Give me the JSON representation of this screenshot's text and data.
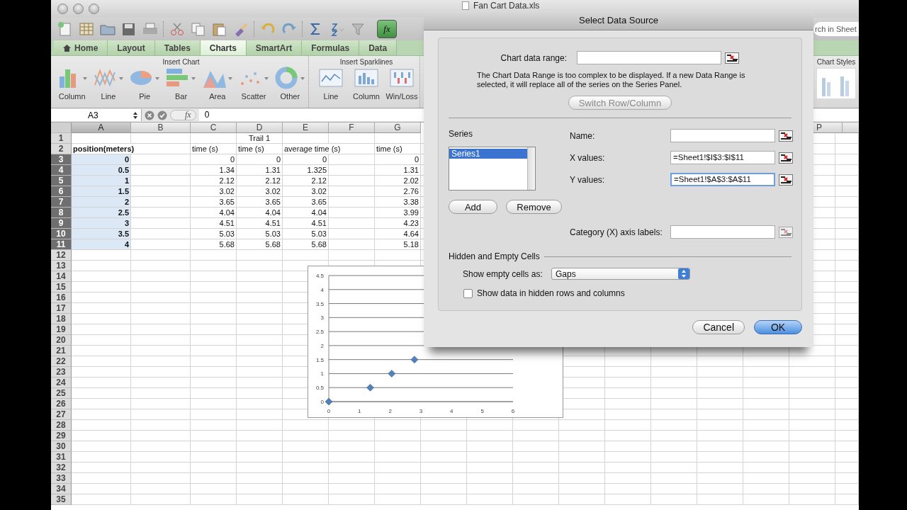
{
  "window": {
    "title": "Fan Cart Data.xls"
  },
  "toolbar": {
    "formula_builder": "fx",
    "search": {
      "placeholder": "rch in Sheet"
    }
  },
  "tabs": [
    {
      "label": "Home",
      "selected": false
    },
    {
      "label": "Layout",
      "selected": false
    },
    {
      "label": "Tables",
      "selected": false
    },
    {
      "label": "Charts",
      "selected": true
    },
    {
      "label": "SmartArt",
      "selected": false
    },
    {
      "label": "Formulas",
      "selected": false
    },
    {
      "label": "Data",
      "selected": false
    }
  ],
  "ribbon": {
    "groups": [
      {
        "kind": "chart",
        "title": "Insert Chart",
        "buttons": [
          "Column",
          "Line",
          "Pie",
          "Bar",
          "Area",
          "Scatter",
          "Other"
        ]
      },
      {
        "kind": "sparkline",
        "title": "Insert Sparklines",
        "buttons": [
          "Line",
          "Column",
          "Win/Loss"
        ]
      },
      {
        "kind": "styles",
        "title": "Chart Styles"
      }
    ]
  },
  "formula_bar": {
    "cell": "A3",
    "fx": "fx",
    "value": "0"
  },
  "sheet": {
    "columns": [
      {
        "label": "A",
        "selected": true
      },
      {
        "label": "B",
        "selected": false
      },
      {
        "label": "C",
        "selected": false
      },
      {
        "label": "D",
        "selected": false
      },
      {
        "label": "E",
        "selected": false
      },
      {
        "label": "F",
        "selected": false
      },
      {
        "label": "G",
        "selected": false
      },
      {
        "label": "P",
        "selected": false
      }
    ],
    "rows": [
      {
        "label": "1",
        "selected": false,
        "cells": [
          null,
          null,
          null,
          {
            "text": "Trail 1",
            "kind": "title",
            "bold": false,
            "selected": false
          },
          null,
          null,
          null,
          null
        ]
      },
      {
        "label": "2",
        "selected": false,
        "cells": [
          {
            "text": "position(meters)",
            "kind": "text",
            "bold": true,
            "selected": false
          },
          null,
          {
            "text": "time (s)",
            "kind": "text",
            "bold": false,
            "selected": false
          },
          {
            "text": "time (s)",
            "kind": "text",
            "bold": false,
            "selected": false
          },
          {
            "text": "average time (s)",
            "kind": "text",
            "bold": false,
            "selected": false
          },
          null,
          {
            "text": "time (s)",
            "kind": "text",
            "bold": false,
            "selected": false
          },
          null
        ]
      },
      {
        "label": "3",
        "selected": true,
        "cells": [
          {
            "text": "0",
            "kind": "number",
            "bold": true,
            "selected": true
          },
          null,
          {
            "text": "0",
            "kind": "number",
            "bold": false,
            "selected": false
          },
          {
            "text": "0",
            "kind": "number",
            "bold": false,
            "selected": false
          },
          {
            "text": "0",
            "kind": "number",
            "bold": false,
            "selected": false
          },
          null,
          {
            "text": "0",
            "kind": "number",
            "bold": false,
            "selected": false
          },
          null
        ]
      },
      {
        "label": "4",
        "selected": true,
        "cells": [
          {
            "text": "0.5",
            "kind": "number",
            "bold": true,
            "selected": true
          },
          null,
          {
            "text": "1.34",
            "kind": "number",
            "bold": false,
            "selected": false
          },
          {
            "text": "1.31",
            "kind": "number",
            "bold": false,
            "selected": false
          },
          {
            "text": "1.325",
            "kind": "number",
            "bold": false,
            "selected": false
          },
          null,
          {
            "text": "1.31",
            "kind": "number",
            "bold": false,
            "selected": false
          },
          null
        ]
      },
      {
        "label": "5",
        "selected": true,
        "cells": [
          {
            "text": "1",
            "kind": "number",
            "bold": true,
            "selected": true
          },
          null,
          {
            "text": "2.12",
            "kind": "number",
            "bold": false,
            "selected": false
          },
          {
            "text": "2.12",
            "kind": "number",
            "bold": false,
            "selected": false
          },
          {
            "text": "2.12",
            "kind": "number",
            "bold": false,
            "selected": false
          },
          null,
          {
            "text": "2.02",
            "kind": "number",
            "bold": false,
            "selected": false
          },
          null
        ]
      },
      {
        "label": "6",
        "selected": true,
        "cells": [
          {
            "text": "1.5",
            "kind": "number",
            "bold": true,
            "selected": true
          },
          null,
          {
            "text": "3.02",
            "kind": "number",
            "bold": false,
            "selected": false
          },
          {
            "text": "3.02",
            "kind": "number",
            "bold": false,
            "selected": false
          },
          {
            "text": "3.02",
            "kind": "number",
            "bold": false,
            "selected": false
          },
          null,
          {
            "text": "2.76",
            "kind": "number",
            "bold": false,
            "selected": false
          },
          null
        ]
      },
      {
        "label": "7",
        "selected": true,
        "cells": [
          {
            "text": "2",
            "kind": "number",
            "bold": true,
            "selected": true
          },
          null,
          {
            "text": "3.65",
            "kind": "number",
            "bold": false,
            "selected": false
          },
          {
            "text": "3.65",
            "kind": "number",
            "bold": false,
            "selected": false
          },
          {
            "text": "3.65",
            "kind": "number",
            "bold": false,
            "selected": false
          },
          null,
          {
            "text": "3.38",
            "kind": "number",
            "bold": false,
            "selected": false
          },
          null
        ]
      },
      {
        "label": "8",
        "selected": true,
        "cells": [
          {
            "text": "2.5",
            "kind": "number",
            "bold": true,
            "selected": true
          },
          null,
          {
            "text": "4.04",
            "kind": "number",
            "bold": false,
            "selected": false
          },
          {
            "text": "4.04",
            "kind": "number",
            "bold": false,
            "selected": false
          },
          {
            "text": "4.04",
            "kind": "number",
            "bold": false,
            "selected": false
          },
          null,
          {
            "text": "3.99",
            "kind": "number",
            "bold": false,
            "selected": false
          },
          null
        ]
      },
      {
        "label": "9",
        "selected": true,
        "cells": [
          {
            "text": "3",
            "kind": "number",
            "bold": true,
            "selected": true
          },
          null,
          {
            "text": "4.51",
            "kind": "number",
            "bold": false,
            "selected": false
          },
          {
            "text": "4.51",
            "kind": "number",
            "bold": false,
            "selected": false
          },
          {
            "text": "4.51",
            "kind": "number",
            "bold": false,
            "selected": false
          },
          null,
          {
            "text": "4.23",
            "kind": "number",
            "bold": false,
            "selected": false
          },
          null
        ]
      },
      {
        "label": "10",
        "selected": true,
        "cells": [
          {
            "text": "3.5",
            "kind": "number",
            "bold": true,
            "selected": true
          },
          null,
          {
            "text": "5.03",
            "kind": "number",
            "bold": false,
            "selected": false
          },
          {
            "text": "5.03",
            "kind": "number",
            "bold": false,
            "selected": false
          },
          {
            "text": "5.03",
            "kind": "number",
            "bold": false,
            "selected": false
          },
          null,
          {
            "text": "4.64",
            "kind": "number",
            "bold": false,
            "selected": false
          },
          null
        ]
      },
      {
        "label": "11",
        "selected": true,
        "cells": [
          {
            "text": "4",
            "kind": "number",
            "bold": true,
            "selected": true
          },
          null,
          {
            "text": "5.68",
            "kind": "number",
            "bold": false,
            "selected": false
          },
          {
            "text": "5.68",
            "kind": "number",
            "bold": false,
            "selected": false
          },
          {
            "text": "5.68",
            "kind": "number",
            "bold": false,
            "selected": false
          },
          null,
          {
            "text": "5.18",
            "kind": "number",
            "bold": false,
            "selected": false
          },
          null
        ]
      },
      {
        "label": "12",
        "selected": false
      },
      {
        "label": "13",
        "selected": false
      },
      {
        "label": "14",
        "selected": false
      },
      {
        "label": "15",
        "selected": false
      },
      {
        "label": "16",
        "selected": false
      },
      {
        "label": "17",
        "selected": false
      },
      {
        "label": "18",
        "selected": false
      },
      {
        "label": "19",
        "selected": false
      },
      {
        "label": "20",
        "selected": false
      },
      {
        "label": "21",
        "selected": false
      },
      {
        "label": "22",
        "selected": false
      },
      {
        "label": "23",
        "selected": false
      },
      {
        "label": "24",
        "selected": false
      },
      {
        "label": "25",
        "selected": false
      },
      {
        "label": "26",
        "selected": false
      },
      {
        "label": "27",
        "selected": false
      },
      {
        "label": "28",
        "selected": false
      },
      {
        "label": "29",
        "selected": false
      },
      {
        "label": "30",
        "selected": false
      },
      {
        "label": "31",
        "selected": false
      },
      {
        "label": "32",
        "selected": false
      },
      {
        "label": "33",
        "selected": false
      },
      {
        "label": "34",
        "selected": false
      },
      {
        "label": "35",
        "selected": false
      }
    ]
  },
  "chart": {
    "chart_data": {
      "type": "scatter",
      "grid": true,
      "x": [
        0,
        1.35,
        2.05,
        2.79
      ],
      "series": [
        {
          "color": "#4f81bd",
          "values": [
            0,
            0.5,
            1,
            1.5
          ]
        }
      ],
      "xlim": [
        0,
        6
      ],
      "ylim": [
        0,
        4.5
      ],
      "xticks": [
        {
          "value": 0,
          "label": "0"
        },
        {
          "value": 1,
          "label": "1"
        },
        {
          "value": 2,
          "label": "2"
        },
        {
          "value": 3,
          "label": "3"
        },
        {
          "value": 4,
          "label": "4"
        },
        {
          "value": 5,
          "label": "5"
        },
        {
          "value": 6,
          "label": "6"
        }
      ],
      "yticks": [
        {
          "value": 0,
          "label": "0"
        },
        {
          "value": 0.5,
          "label": "0.5"
        },
        {
          "value": 1,
          "label": "1"
        },
        {
          "value": 1.5,
          "label": "1.5"
        },
        {
          "value": 2,
          "label": "2"
        },
        {
          "value": 2.5,
          "label": "2.5"
        },
        {
          "value": 3,
          "label": "3"
        },
        {
          "value": 3.5,
          "label": "3.5"
        },
        {
          "value": 4,
          "label": "4"
        },
        {
          "value": 4.5,
          "label": "4.5"
        }
      ]
    }
  },
  "dialog": {
    "title": "Select Data Source",
    "chart_data_range": {
      "label": "Chart data range:"
    },
    "note": "The Chart Data Range is too complex to be displayed. If a new Data Range is selected, it will replace all of the series on the Series Panel.",
    "switch_button": {
      "label": "Switch Row/Column",
      "disabled": true
    },
    "series_label": "Series",
    "series": [
      {
        "name": "Series1",
        "selected": true
      }
    ],
    "add_button": "Add",
    "remove_button": "Remove",
    "fields": [
      {
        "label": "Name:",
        "focused": false
      },
      {
        "label": "X values:",
        "value": "=Sheet1!$I$3:$I$11",
        "focused": false
      },
      {
        "label": "Y values:",
        "value": "=Sheet1!$A$3:$A$11",
        "focused": true
      }
    ],
    "category_field": {
      "label": "Category (X) axis labels:"
    },
    "hidden_section": "Hidden and Empty Cells",
    "empty_cells": {
      "label": "Show empty cells as:",
      "value": "Gaps"
    },
    "hidden_checkbox": {
      "label": "Show data in hidden rows and columns",
      "checked": false
    },
    "buttons": [
      {
        "label": "Cancel",
        "default": false
      },
      {
        "label": "OK",
        "default": true
      }
    ]
  }
}
